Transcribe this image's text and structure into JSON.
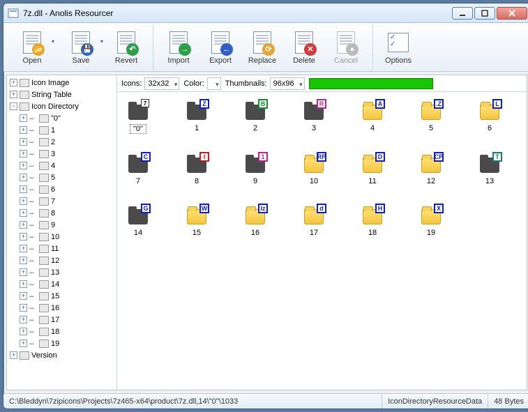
{
  "window": {
    "title": "7z.dll - Anolis Resourcer"
  },
  "toolbar": {
    "open": "Open",
    "save": "Save",
    "revert": "Revert",
    "import": "Import",
    "export": "Export",
    "replace": "Replace",
    "delete": "Delete",
    "cancel": "Cancel",
    "options": "Options"
  },
  "tree": {
    "roots": [
      {
        "label": "Icon Image",
        "expand": "+"
      },
      {
        "label": "String Table",
        "expand": "+"
      },
      {
        "label": "Icon Directory",
        "expand": "−",
        "children": [
          "\"0\"",
          "1",
          "2",
          "3",
          "4",
          "5",
          "6",
          "7",
          "8",
          "9",
          "10",
          "11",
          "12",
          "13",
          "14",
          "15",
          "16",
          "17",
          "18",
          "19"
        ]
      },
      {
        "label": "Version",
        "expand": "+"
      }
    ]
  },
  "options_bar": {
    "icons_label": "Icons:",
    "icons_value": "32x32",
    "color_label": "Color:",
    "thumbs_label": "Thumbnails:",
    "thumbs_value": "96x96"
  },
  "items": [
    {
      "cap": "\"0\"",
      "style": "dark",
      "badge": "7",
      "badgecls": "corner",
      "sel": true
    },
    {
      "cap": "1",
      "style": "dark",
      "badge": "Z",
      "badgecls": ""
    },
    {
      "cap": "2",
      "style": "dark",
      "badge": "B",
      "badgecls": "green"
    },
    {
      "cap": "3",
      "style": "dark",
      "badge": "R",
      "badgecls": "pink"
    },
    {
      "cap": "4",
      "style": "yel",
      "badge": "A",
      "badgecls": ""
    },
    {
      "cap": "5",
      "style": "yel",
      "badge": ".Z",
      "badgecls": ""
    },
    {
      "cap": "6",
      "style": "yel",
      "badge": "L",
      "badgecls": ""
    },
    {
      "cap": "7",
      "style": "dark",
      "badge": "C",
      "badgecls": ""
    },
    {
      "cap": "8",
      "style": "dark",
      "badge": "I",
      "badgecls": "red"
    },
    {
      "cap": "9",
      "style": "dark",
      "badge": "1",
      "badgecls": "pink"
    },
    {
      "cap": "10",
      "style": "yel",
      "badge": "RP",
      "badgecls": ""
    },
    {
      "cap": "11",
      "style": "yel",
      "badge": "D",
      "badgecls": ""
    },
    {
      "cap": "12",
      "style": "yel",
      "badge": "CP",
      "badgecls": ""
    },
    {
      "cap": "13",
      "style": "dark",
      "badge": "T",
      "badgecls": "teal"
    },
    {
      "cap": "14",
      "style": "dark",
      "badge": "G",
      "badgecls": ""
    },
    {
      "cap": "15",
      "style": "yel",
      "badge": "W",
      "badgecls": ""
    },
    {
      "cap": "16",
      "style": "yel",
      "badge": "lz",
      "badgecls": ""
    },
    {
      "cap": "17",
      "style": "yel",
      "badge": "d",
      "badgecls": ""
    },
    {
      "cap": "18",
      "style": "yel",
      "badge": "H",
      "badgecls": ""
    },
    {
      "cap": "19",
      "style": "yel",
      "badge": "X",
      "badgecls": ""
    }
  ],
  "status": {
    "path": "C:\\Bleddyn\\7zipicons\\Projects\\7z465-x64\\product\\7z.dll,14\\\"0\"\\1033",
    "type": "IconDirectoryResourceData",
    "size": "48 Bytes"
  }
}
